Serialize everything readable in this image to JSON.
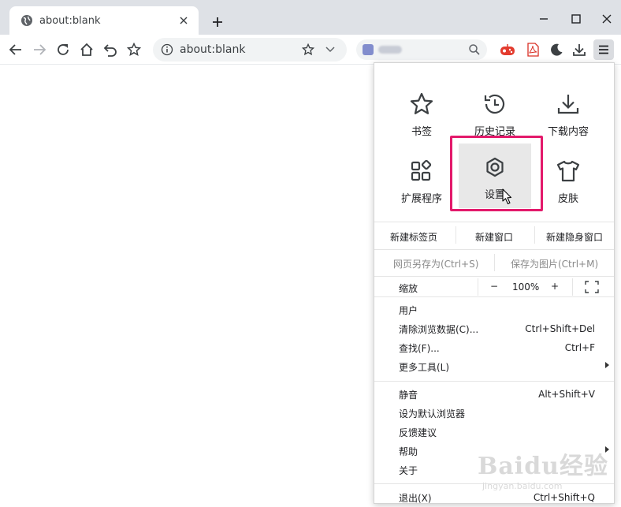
{
  "tab": {
    "title": "about:blank",
    "icon": "globe-icon"
  },
  "omnibox": {
    "url": "about:blank"
  },
  "menu": {
    "tiles": [
      {
        "label": "书签",
        "icon": "bookmark-star-icon"
      },
      {
        "label": "历史记录",
        "icon": "history-icon"
      },
      {
        "label": "下载内容",
        "icon": "download-icon"
      },
      {
        "label": "扩展程序",
        "icon": "extensions-icon"
      },
      {
        "label": "设置",
        "icon": "gear-icon"
      },
      {
        "label": "皮肤",
        "icon": "shirt-icon"
      }
    ],
    "row_new": [
      "新建标签页",
      "新建窗口",
      "新建隐身窗口"
    ],
    "row_save": [
      "网页另存为(Ctrl+S)",
      "保存为图片(Ctrl+M)"
    ],
    "zoom": {
      "label": "缩放",
      "minus": "−",
      "value": "100%",
      "plus": "+"
    },
    "group1": [
      {
        "label": "用户",
        "shortcut": ""
      },
      {
        "label": "清除浏览数据(C)...",
        "shortcut": "Ctrl+Shift+Del"
      },
      {
        "label": "查找(F)...",
        "shortcut": "Ctrl+F"
      },
      {
        "label": "更多工具(L)",
        "shortcut": ""
      }
    ],
    "group2": [
      {
        "label": "静音",
        "shortcut": "Alt+Shift+V"
      },
      {
        "label": "设为默认浏览器",
        "shortcut": ""
      },
      {
        "label": "反馈建议",
        "shortcut": ""
      },
      {
        "label": "帮助",
        "shortcut": ""
      },
      {
        "label": "关于",
        "shortcut": ""
      }
    ],
    "exit": {
      "label": "退出(X)",
      "shortcut": "Ctrl+Shift+Q"
    }
  },
  "colors": {
    "highlight": "#e3196b",
    "tabstrip": "#dee1e6"
  },
  "watermark": {
    "brand": "Baidu经验",
    "sub": "jingyan.baidu.com"
  }
}
